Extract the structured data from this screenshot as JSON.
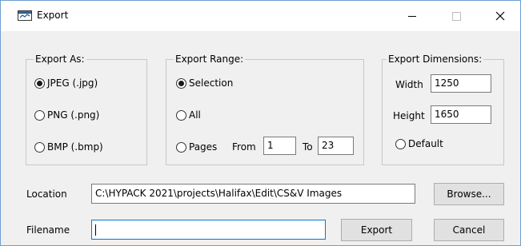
{
  "window": {
    "title": "Export"
  },
  "titlebar": {
    "minimize_glyph": "—",
    "maximize_glyph": "☐",
    "close_glyph": "✕"
  },
  "export_as": {
    "label": "Export As:",
    "options": [
      {
        "label": "JPEG (.jpg)",
        "checked": true
      },
      {
        "label": "PNG (.png)",
        "checked": false
      },
      {
        "label": "BMP (.bmp)",
        "checked": false
      }
    ]
  },
  "export_range": {
    "label": "Export Range:",
    "options": [
      {
        "label": "Selection",
        "checked": true
      },
      {
        "label": "All",
        "checked": false
      },
      {
        "label": "Pages",
        "checked": false
      }
    ],
    "from_label": "From",
    "from_value": "1",
    "to_label": "To",
    "to_value": "23"
  },
  "export_dimensions": {
    "label": "Export Dimensions:",
    "width_label": "Width",
    "width_value": "1250",
    "height_label": "Height",
    "height_value": "1650",
    "default_label": "Default"
  },
  "location": {
    "label": "Location",
    "value": "C:\\HYPACK 2021\\projects\\Halifax\\Edit\\CS&V Images",
    "browse_label": "Browse..."
  },
  "filename": {
    "label": "Filename",
    "value": "",
    "export_label": "Export",
    "cancel_label": "Cancel"
  },
  "colors": {
    "accent": "#0078d7",
    "dialog_bg": "#f0f0f0",
    "titlebar_bg": "#ffffff",
    "button_bg": "#e1e1e1",
    "border": "#7a7a7a"
  }
}
